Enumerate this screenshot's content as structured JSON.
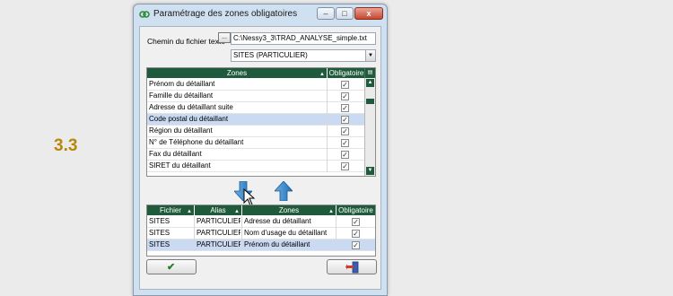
{
  "step_label": "3.3",
  "window": {
    "title": "Paramétrage des zones obligatoires",
    "btn_min": "–",
    "btn_max": "□",
    "btn_close": "x"
  },
  "form": {
    "path_label": "Chemin du fichier texte",
    "browse_label": "...",
    "path_value": "C:\\Nessy3_3\\TRAD_ANALYSE_simple.txt",
    "file_select_value": "SITES (PARTICULIER)"
  },
  "grid_zones": {
    "headers": [
      "Zones",
      "Obligatoire"
    ],
    "rows": [
      {
        "zone": "Prénom du détaillant",
        "checked": "✓"
      },
      {
        "zone": "Famille du détaillant",
        "checked": "✓"
      },
      {
        "zone": "Adresse du détaillant suite",
        "checked": "✓"
      },
      {
        "zone": "Code postal du détaillant",
        "checked": "✓"
      },
      {
        "zone": "Région du détaillant",
        "checked": "✓"
      },
      {
        "zone": "N° de Téléphone du détaillant",
        "checked": "✓"
      },
      {
        "zone": "Fax du détaillant",
        "checked": "✓"
      },
      {
        "zone": "SIRET du détaillant",
        "checked": "✓"
      }
    ]
  },
  "grid_selected": {
    "headers": [
      "Fichier",
      "Alias",
      "Zones",
      "Obligatoire"
    ],
    "rows": [
      {
        "fichier": "SITES",
        "alias": "PARTICULIER",
        "zone": "Adresse du détaillant",
        "checked": "✓"
      },
      {
        "fichier": "SITES",
        "alias": "PARTICULIER",
        "zone": "Nom d'usage du détaillant",
        "checked": "✓"
      },
      {
        "fichier": "SITES",
        "alias": "PARTICULIER",
        "zone": "Prénom du détaillant",
        "checked": "✓"
      }
    ]
  },
  "buttons": {
    "ok_icon": "✔"
  },
  "colors": {
    "grid_header": "#1f5a3c",
    "selection": "#c9daf2",
    "arrow_blue": "#2f7fc1",
    "step_label": "#b8860b"
  }
}
